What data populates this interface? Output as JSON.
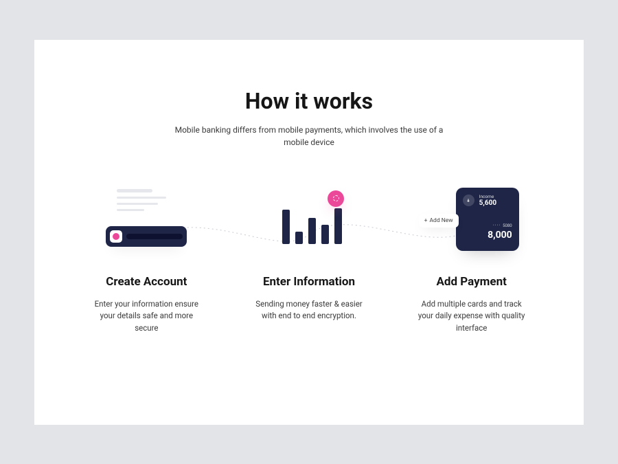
{
  "heading": "How it works",
  "subheading": "Mobile banking differs from mobile payments, which involves the use of a mobile device",
  "steps": [
    {
      "title": "Create Account",
      "desc": "Enter your information ensure your details safe and more secure"
    },
    {
      "title": "Enter Information",
      "desc": "Sending money faster & easier with end to end encryption."
    },
    {
      "title": "Add Payment",
      "desc": "Add multiple cards and track your daily expense with quality interface"
    }
  ],
  "card": {
    "income_label": "Income",
    "income_value": "5,600",
    "masked": "····",
    "code": "5080",
    "amount": "8,000",
    "add_new": "Add New"
  }
}
